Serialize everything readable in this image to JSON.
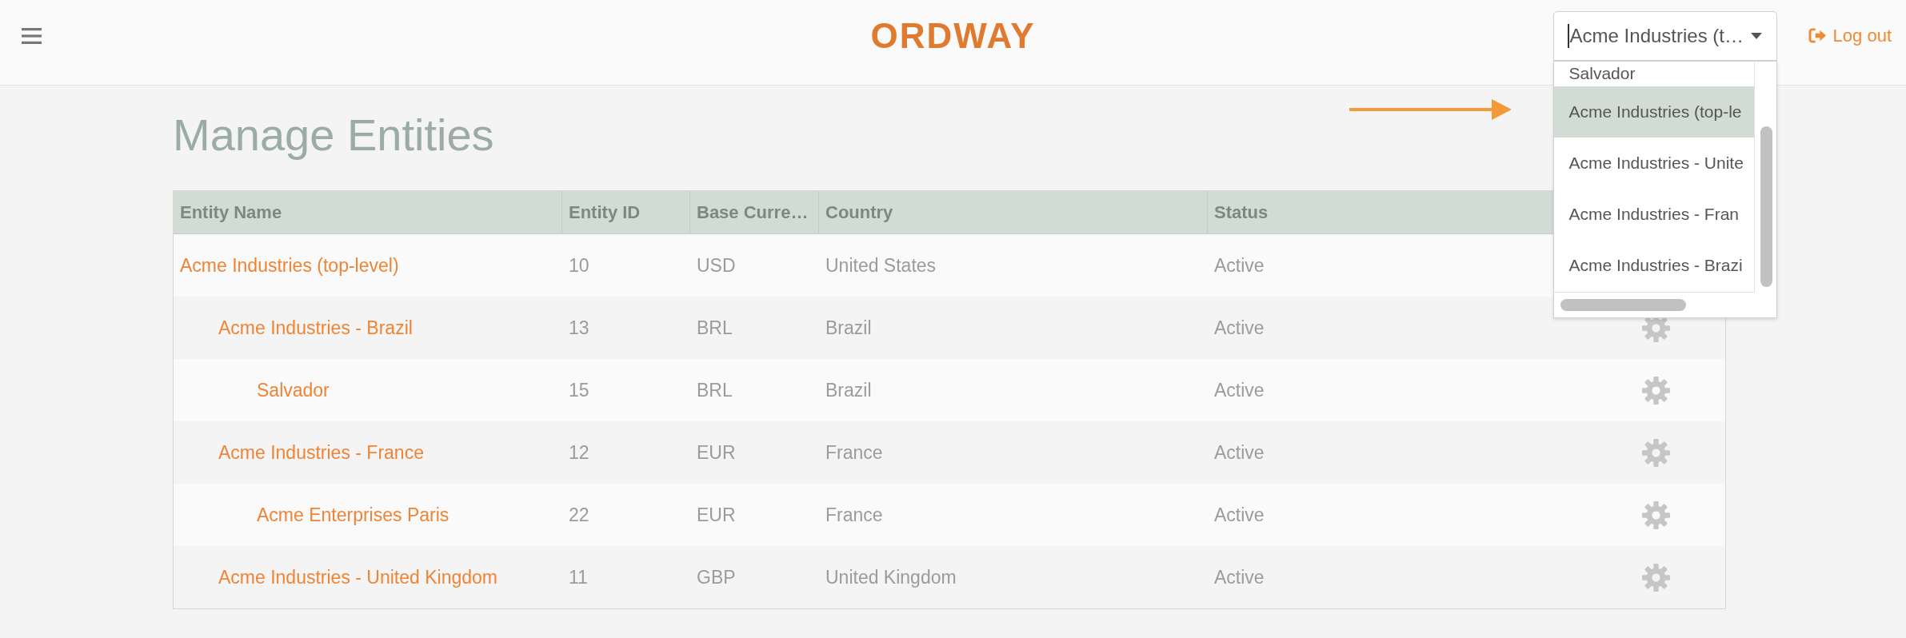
{
  "header": {
    "logo": "ORDWAY",
    "entity_select": {
      "value": "Acme Industries (t…",
      "focused": true,
      "expanded": true,
      "options": [
        {
          "label": "Salvador",
          "selected": false
        },
        {
          "label": "Acme Industries (top-le",
          "selected": true
        },
        {
          "label": "Acme Industries - Unite",
          "selected": false
        },
        {
          "label": "Acme Industries - Fran",
          "selected": false
        },
        {
          "label": "Acme Industries - Brazi",
          "selected": false
        }
      ]
    },
    "logout": "Log out"
  },
  "page_title": "Manage Entities",
  "table": {
    "columns": [
      "Entity Name",
      "Entity ID",
      "Base Curre…",
      "Country",
      "Status"
    ],
    "rows": [
      {
        "entity_name": "Acme Industries (top-level)",
        "entity_id": "10",
        "column_3": "USD",
        "country": "United States",
        "status": "Active",
        "settings_icon": false,
        "children": [
          {
            "entity_name": "Acme Industries - Brazil",
            "entity_id": "13",
            "column_3": "BRL",
            "country": "Brazil",
            "status": "Active",
            "settings_icon": true,
            "children": [
              {
                "entity_name": "Salvador",
                "entity_id": "15",
                "column_3": "BRL",
                "country": "Brazil",
                "status": "Active",
                "settings_icon": true
              }
            ]
          },
          {
            "entity_name": "Acme Industries - France",
            "entity_id": "12",
            "column_3": "EUR",
            "country": "France",
            "status": "Active",
            "settings_icon": true,
            "children": [
              {
                "entity_name": "Acme Enterprises Paris",
                "entity_id": "22",
                "column_3": "EUR",
                "country": "France",
                "status": "Active",
                "settings_icon": true
              }
            ]
          },
          {
            "entity_name": "Acme Industries - United Kingdom",
            "entity_id": "11",
            "column_3": "GBP",
            "country": "United Kingdom",
            "status": "Active",
            "settings_icon": true
          }
        ]
      }
    ]
  }
}
